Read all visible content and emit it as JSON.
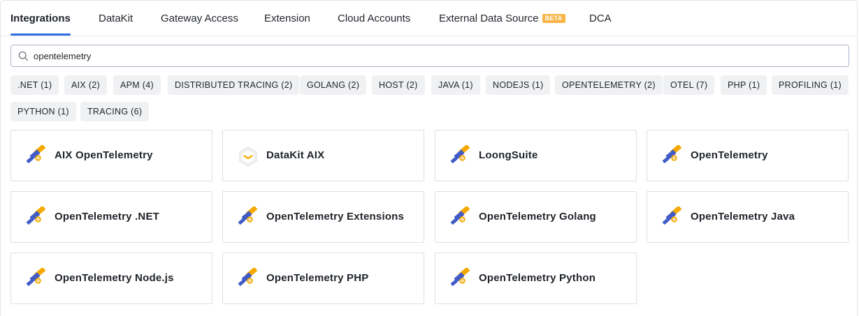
{
  "tabs": [
    {
      "label": "Integrations",
      "active": true
    },
    {
      "label": "DataKit"
    },
    {
      "label": "Gateway Access"
    },
    {
      "label": "Extension"
    },
    {
      "label": "Cloud Accounts"
    },
    {
      "label": "External Data Source",
      "badge": "BETA"
    },
    {
      "label": "DCA"
    }
  ],
  "search": {
    "value": "opentelemetry"
  },
  "tags": [
    ".NET (1)",
    "AIX (2)",
    "APM (4)",
    "DISTRIBUTED TRACING (2)",
    "GOLANG (2)",
    "HOST (2)",
    "JAVA (1)",
    "NODEJS (1)",
    "OPENTELEMETRY (2)",
    "OTEL (7)",
    "PHP (1)",
    "PROFILING (1)",
    "PYTHON (1)",
    "TRACING (6)"
  ],
  "cards": [
    {
      "name": "AIX OpenTelemetry",
      "icon": "telescope-icon"
    },
    {
      "name": "DataKit AIX",
      "icon": "datakit-icon"
    },
    {
      "name": "LoongSuite",
      "icon": "telescope-icon"
    },
    {
      "name": "OpenTelemetry",
      "icon": "telescope-icon"
    },
    {
      "name": "OpenTelemetry .NET",
      "icon": "telescope-icon"
    },
    {
      "name": "OpenTelemetry Extensions",
      "icon": "telescope-icon"
    },
    {
      "name": "OpenTelemetry Golang",
      "icon": "telescope-icon"
    },
    {
      "name": "OpenTelemetry Java",
      "icon": "telescope-icon"
    },
    {
      "name": "OpenTelemetry Node.js",
      "icon": "telescope-icon"
    },
    {
      "name": "OpenTelemetry PHP",
      "icon": "telescope-icon"
    },
    {
      "name": "OpenTelemetry Python",
      "icon": "telescope-icon"
    }
  ],
  "colors": {
    "accent": "#2f6fdf",
    "beta_badge": "#f7b547",
    "otel_orange": "#f5a800",
    "otel_blue": "#425cc7",
    "tag_bg": "#f0f1f3"
  }
}
